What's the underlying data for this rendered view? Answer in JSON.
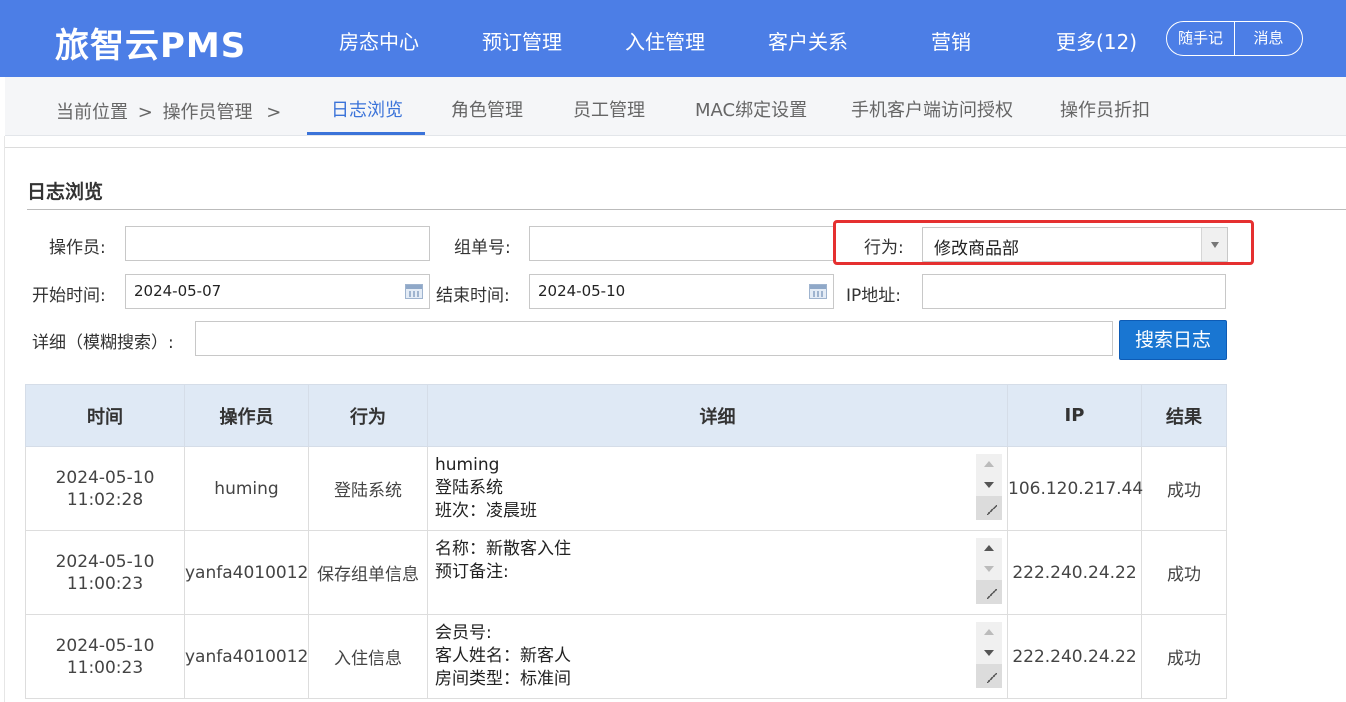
{
  "header": {
    "logo": "旅智云PMS",
    "nav": [
      "房态中心",
      "预订管理",
      "入住管理",
      "客户关系",
      "营销",
      "更多(12)"
    ],
    "quick_note": "随手记",
    "messages": "消息"
  },
  "breadcrumb": {
    "current_location": "当前位置",
    "sep": ">",
    "parent": "操作员管理"
  },
  "subtabs": [
    "日志浏览",
    "角色管理",
    "员工管理",
    "MAC绑定设置",
    "手机客户端访问授权",
    "操作员折扣"
  ],
  "active_subtab": "日志浏览",
  "section_title": "日志浏览",
  "filters": {
    "operator_label": "操作员:",
    "operator_value": "",
    "order_label": "组单号:",
    "order_value": "",
    "action_label": "行为:",
    "action_value": "修改商品部",
    "start_label": "开始时间:",
    "start_value": "2024-05-07",
    "end_label": "结束时间:",
    "end_value": "2024-05-10",
    "ip_label": "IP地址:",
    "ip_value": "",
    "detail_label": "详细（模糊搜索）:",
    "detail_value": "",
    "search_button": "搜索日志"
  },
  "table": {
    "columns": [
      "时间",
      "操作员",
      "行为",
      "详细",
      "IP",
      "结果"
    ],
    "rows": [
      {
        "date": "2024-05-10",
        "time": "11:02:28",
        "operator": "huming",
        "action": "登陆系统",
        "detail": "huming\n登陆系统\n班次：凌晨班",
        "ip": "106.120.217.44",
        "result": "成功"
      },
      {
        "date": "2024-05-10",
        "time": "11:00:23",
        "operator": "yanfa4010012",
        "action": "保存组单信息",
        "detail": "名称：新散客入住\n预订备注:",
        "ip": "222.240.24.22",
        "result": "成功"
      },
      {
        "date": "2024-05-10",
        "time": "11:00:23",
        "operator": "yanfa4010012",
        "action": "入住信息",
        "detail": "会员号:\n客人姓名：新客人\n房间类型：标准间",
        "ip": "222.240.24.22",
        "result": "成功"
      }
    ]
  },
  "colors": {
    "header_bg": "#4c7ee6",
    "active_tab": "#3b73d9",
    "search_button": "#1976d2",
    "highlight_box": "#e53030"
  }
}
